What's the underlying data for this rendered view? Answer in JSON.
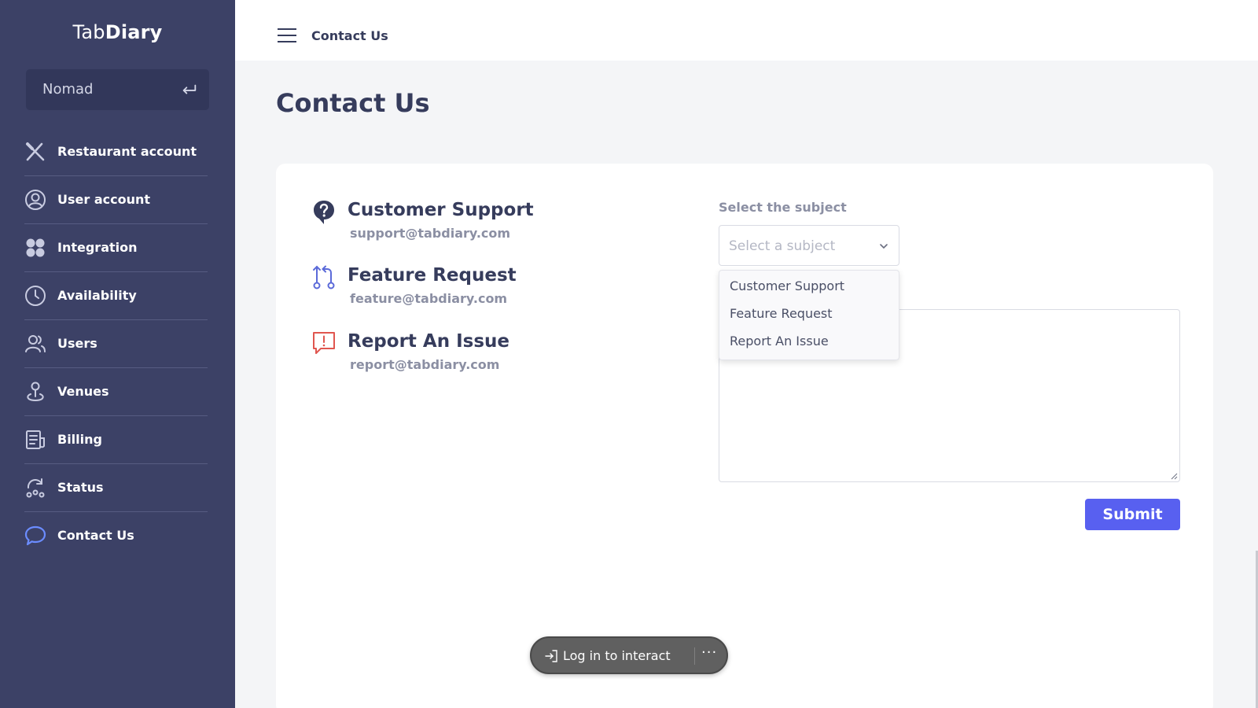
{
  "app": {
    "logo_light": "Tab",
    "logo_bold": "Diary",
    "venue": "Nomad"
  },
  "sidebar": {
    "items": [
      {
        "label": "Restaurant account",
        "icon": "utensils-icon"
      },
      {
        "label": "User account",
        "icon": "user-circle-icon"
      },
      {
        "label": "Integration",
        "icon": "grid-icon"
      },
      {
        "label": "Availability",
        "icon": "clock-icon"
      },
      {
        "label": "Users",
        "icon": "users-icon"
      },
      {
        "label": "Venues",
        "icon": "location-pin-icon"
      },
      {
        "label": "Billing",
        "icon": "billing-icon"
      },
      {
        "label": "Status",
        "icon": "status-icon"
      },
      {
        "label": "Contact Us",
        "icon": "chat-bubble-icon",
        "active": true
      }
    ]
  },
  "header": {
    "breadcrumb": "Contact Us"
  },
  "main": {
    "title": "Contact Us",
    "contacts": [
      {
        "title": "Customer Support",
        "email": "support@tabdiary.com",
        "icon": "question-icon"
      },
      {
        "title": "Feature Request",
        "email": "feature@tabdiary.com",
        "icon": "git-pull-icon"
      },
      {
        "title": "Report An Issue",
        "email": "report@tabdiary.com",
        "icon": "report-icon"
      }
    ],
    "form": {
      "subject_label": "Select the subject",
      "subject_placeholder": "Select a subject",
      "subject_options": [
        "Customer Support",
        "Feature Request",
        "Report An Issue"
      ],
      "submit_label": "Submit"
    }
  },
  "overlay": {
    "login_text": "Log in to interact",
    "more": "···"
  },
  "colors": {
    "sidebar_bg": "#3c4166",
    "accent": "#5860f0",
    "text_dark": "#363c5c",
    "text_muted": "#8b8fa3",
    "active_icon": "#6b8cff",
    "icon_red": "#e0564f"
  }
}
